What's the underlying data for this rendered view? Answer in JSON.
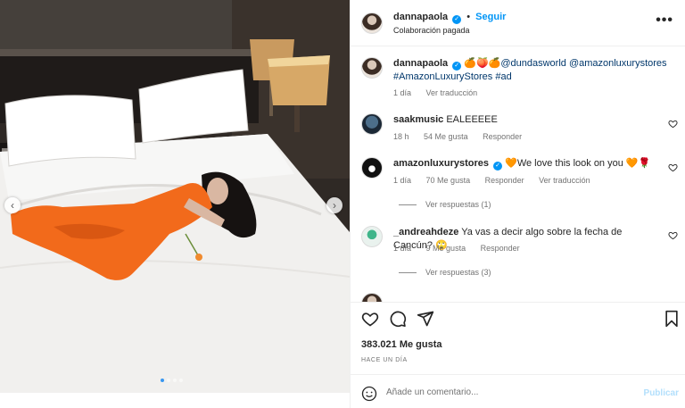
{
  "post": {
    "author": "dannapaola",
    "follow_label": "Seguir",
    "subtitle": "Colaboración pagada",
    "more_label": "•••",
    "image_alt": "",
    "carousel": {
      "slides": 4,
      "active": 0
    }
  },
  "caption": {
    "username": "dannapaola",
    "emojis": "🍊🍑🍊",
    "text_line1": "@dundasworld @amazonluxurystores",
    "text_line2": "#AmazonLuxuryStores #ad",
    "time": "1 día",
    "translate": "Ver traducción"
  },
  "comments": [
    {
      "username": "saakmusic",
      "verified": false,
      "text": "EALEEEEE",
      "time": "18 h",
      "likes": "54 Me gusta",
      "reply": "Responder",
      "translate": ""
    },
    {
      "username": "amazonluxurystores",
      "verified": true,
      "text": "We love this look on you",
      "emoji_pre": "🧡",
      "emoji_post": "🧡🌹",
      "time": "1 día",
      "likes": "70 Me gusta",
      "reply": "Responder",
      "translate": "Ver traducción",
      "replies": "Ver respuestas (1)"
    },
    {
      "username": "_andreahdeze",
      "verified": false,
      "text": "Ya vas a decir algo sobre la fecha de Cancún?",
      "emoji_post": "🙄",
      "time": "1 día",
      "likes": "9 Me gusta",
      "reply": "Responder",
      "replies": "Ver respuestas (3)"
    }
  ],
  "actions": {
    "likes": "383.021 Me gusta",
    "time": "HACE UN DÍA"
  },
  "comment_box": {
    "placeholder": "Añade un comentario...",
    "publish": "Publicar"
  },
  "colors": {
    "accent": "#0095f6",
    "link": "#00376b",
    "publish_disabled": "#b2dffc",
    "outfit": "#f26a1b"
  }
}
